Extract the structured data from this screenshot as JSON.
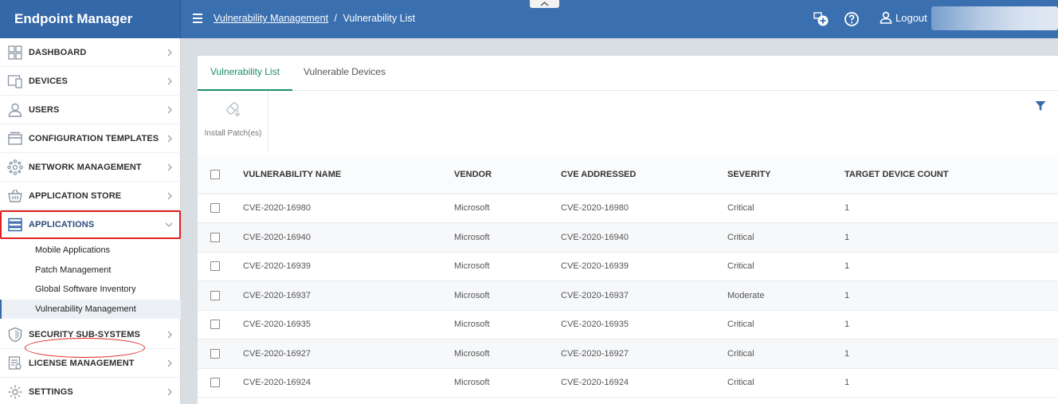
{
  "app": {
    "title": "Endpoint Manager"
  },
  "header": {
    "breadcrumb": {
      "parent": "Vulnerability Management",
      "separator": "/",
      "current": "Vulnerability List"
    },
    "logout_label": "Logout",
    "icons": [
      "hamburger-icon",
      "add-device-icon",
      "help-icon",
      "user-icon"
    ]
  },
  "sidebar": {
    "items": [
      {
        "label": "DASHBOARD",
        "icon": "dashboard-icon"
      },
      {
        "label": "DEVICES",
        "icon": "devices-icon"
      },
      {
        "label": "USERS",
        "icon": "user-icon"
      },
      {
        "label": "CONFIGURATION TEMPLATES",
        "icon": "templates-icon"
      },
      {
        "label": "NETWORK MANAGEMENT",
        "icon": "network-icon"
      },
      {
        "label": "APPLICATION STORE",
        "icon": "store-icon"
      },
      {
        "label": "APPLICATIONS",
        "icon": "applications-icon",
        "expanded": true
      },
      {
        "label": "SECURITY SUB-SYSTEMS",
        "icon": "shield-icon"
      },
      {
        "label": "LICENSE MANAGEMENT",
        "icon": "license-icon"
      },
      {
        "label": "SETTINGS",
        "icon": "gear-icon"
      }
    ],
    "sub_items": [
      {
        "label": "Mobile Applications"
      },
      {
        "label": "Patch Management"
      },
      {
        "label": "Global Software Inventory"
      },
      {
        "label": "Vulnerability Management",
        "selected": true
      }
    ]
  },
  "main": {
    "tabs": [
      {
        "label": "Vulnerability List",
        "active": true
      },
      {
        "label": "Vulnerable Devices",
        "active": false
      }
    ],
    "toolbar": {
      "install_label": "Install Patch(es)"
    },
    "table": {
      "columns": [
        "VULNERABILITY NAME",
        "VENDOR",
        "CVE ADDRESSED",
        "SEVERITY",
        "TARGET DEVICE COUNT"
      ],
      "rows": [
        {
          "name": "CVE-2020-16980",
          "vendor": "Microsoft",
          "cve": "CVE-2020-16980",
          "severity": "Critical",
          "count": "1"
        },
        {
          "name": "CVE-2020-16940",
          "vendor": "Microsoft",
          "cve": "CVE-2020-16940",
          "severity": "Critical",
          "count": "1"
        },
        {
          "name": "CVE-2020-16939",
          "vendor": "Microsoft",
          "cve": "CVE-2020-16939",
          "severity": "Critical",
          "count": "1"
        },
        {
          "name": "CVE-2020-16937",
          "vendor": "Microsoft",
          "cve": "CVE-2020-16937",
          "severity": "Moderate",
          "count": "1"
        },
        {
          "name": "CVE-2020-16935",
          "vendor": "Microsoft",
          "cve": "CVE-2020-16935",
          "severity": "Critical",
          "count": "1"
        },
        {
          "name": "CVE-2020-16927",
          "vendor": "Microsoft",
          "cve": "CVE-2020-16927",
          "severity": "Critical",
          "count": "1"
        },
        {
          "name": "CVE-2020-16924",
          "vendor": "Microsoft",
          "cve": "CVE-2020-16924",
          "severity": "Critical",
          "count": "1"
        }
      ]
    }
  },
  "colors": {
    "brand": "#3468a8",
    "accent_tab": "#1e8c6e",
    "link": "#2f6cb0",
    "highlight": "#e0201e"
  }
}
